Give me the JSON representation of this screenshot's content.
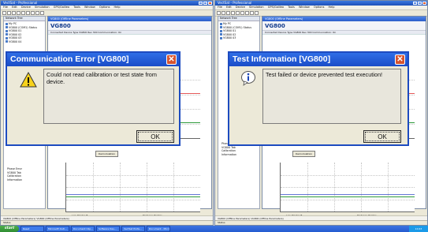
{
  "left_app": {
    "title": "VectSat - Professional",
    "menu": [
      "File",
      "Edit",
      "Device",
      "Simulation",
      "GPS/Galileo",
      "Tools",
      "Window",
      "Options",
      "Help"
    ],
    "panel_header": "Network Tree",
    "tree": [
      "My PC",
      "VG800 (COM1) Status",
      "VG800 01",
      "VG800 02",
      "VG800 03",
      "VG800 04"
    ],
    "subwin_title": "VG800 (Offline Parameters)",
    "device": "VG800",
    "status_line": "Connected   Device Type VG800   Rev 300   Communication: On",
    "demod_button": "Demodulation",
    "tree2": [
      "Phase Error",
      "VG800 Tab",
      "Calibration",
      "Information"
    ],
    "axis_left": "Low Pointer B",
    "axis_right": "Distance Pointer",
    "docbar": "VG800 (Offline Parameters)   VG800 (Offline Parameters)",
    "statusbar": "Status",
    "dialog": {
      "title": "Communication Error [VG800]",
      "message": "Could not read calibration or test state from device.",
      "ok": "OK",
      "icon": "warning-icon"
    }
  },
  "right_app": {
    "title": "VectSat - Professional",
    "menu": [
      "File",
      "Edit",
      "Device",
      "Simulation",
      "GPS/Galileo",
      "Tools",
      "Window",
      "Options",
      "Help"
    ],
    "panel_header": "Network Tree",
    "tree": [
      "My PC",
      "VG800 (COM1) Status",
      "VG800 01",
      "VG800 02",
      "VG800 03"
    ],
    "subwin_title": "VG800 (Offline Parameters)",
    "device": "VG800",
    "status_line": "Connected   Device Type VG800   Rev 300   Communication: On",
    "demod_button": "Demodulation",
    "tree2": [
      "Phase Error",
      "VG800 Tab",
      "Calibration",
      "Information"
    ],
    "axis_left": "Low Pointer B",
    "axis_right": "Distance Pointer",
    "docbar": "VG800 (Offline Parameters)   VG800 (Offline Parameters)",
    "statusbar": "Status",
    "dialog": {
      "title": "Test Information [VG800]",
      "message": "Test failed or device prevented test execution!",
      "ok": "OK",
      "icon": "info-icon"
    }
  },
  "taskbar": {
    "start": "start",
    "tasks": [
      "Reset",
      "Microsoft Outl...",
      "Document Clip...",
      "Software Dev...",
      "VectSat Profe...",
      "Document - Micro..."
    ],
    "tray": "10:43"
  },
  "colors": {
    "dialog_border": "#1d4bc0",
    "title_blue": "#2f6ee6",
    "close_red": "#d6542f",
    "chart_red": "#e45a5a",
    "chart_green": "#2f9a3c"
  }
}
